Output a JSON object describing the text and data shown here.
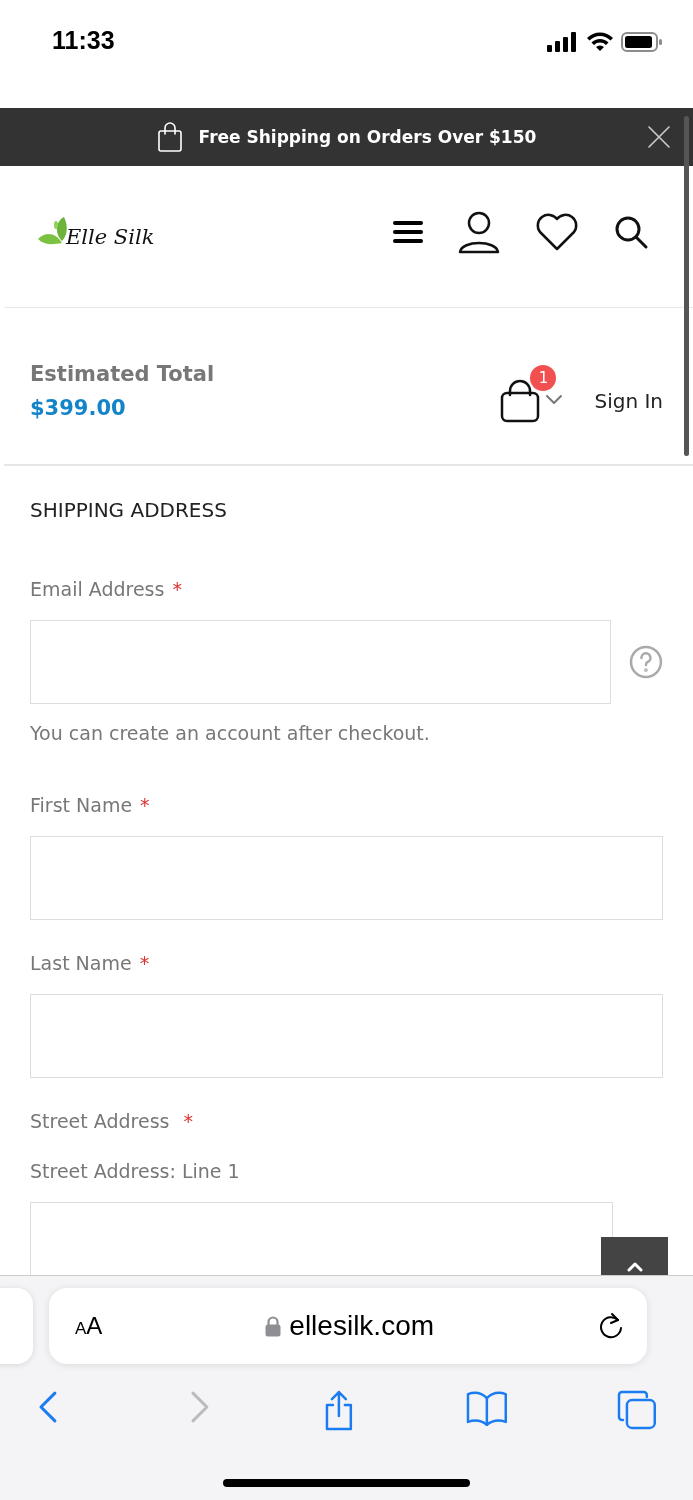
{
  "status_bar": {
    "time": "11:33"
  },
  "promo_bar": {
    "text": "Free Shipping on Orders Over $150"
  },
  "header": {
    "logo": "Elle Silk"
  },
  "summary": {
    "label": "Estimated Total",
    "total": "$399.00",
    "cart_count": "1",
    "sign_in": "Sign In"
  },
  "form": {
    "title": "SHIPPING ADDRESS",
    "fields": [
      {
        "kind": "input",
        "label": "Email Address",
        "required_mark": "*",
        "help": true,
        "hint": "You can create an account after checkout."
      },
      {
        "kind": "input",
        "label": "First Name",
        "required_mark": "*",
        "help": false
      },
      {
        "kind": "input",
        "label": "Last Name",
        "required_mark": "*",
        "help": false
      },
      {
        "kind": "address",
        "label": "Street Address",
        "required_mark": "*",
        "help": false,
        "sublabel": "Street Address: Line 1"
      }
    ]
  },
  "browser": {
    "text_size": "AA",
    "url": "ellesilk.com",
    "forward_disabled": true
  }
}
